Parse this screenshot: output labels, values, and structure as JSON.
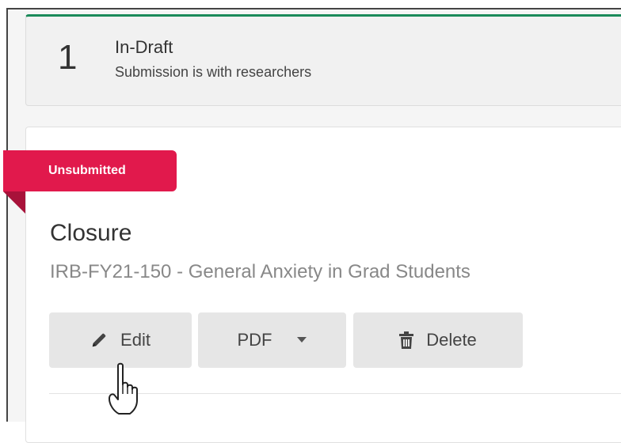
{
  "status": {
    "number": "1",
    "title": "In-Draft",
    "subtitle": "Submission is with researchers",
    "accent_color": "#1b8a5a"
  },
  "submission": {
    "badge": "Unsubmitted",
    "badge_color": "#e1194c",
    "title": "Closure",
    "subtitle": "IRB-FY21-150 - General Anxiety in Grad Students"
  },
  "actions": {
    "edit_label": "Edit",
    "edit_icon": "pencil-icon",
    "pdf_label": "PDF",
    "pdf_icon": "caret-down-icon",
    "delete_label": "Delete",
    "delete_icon": "trash-icon"
  }
}
